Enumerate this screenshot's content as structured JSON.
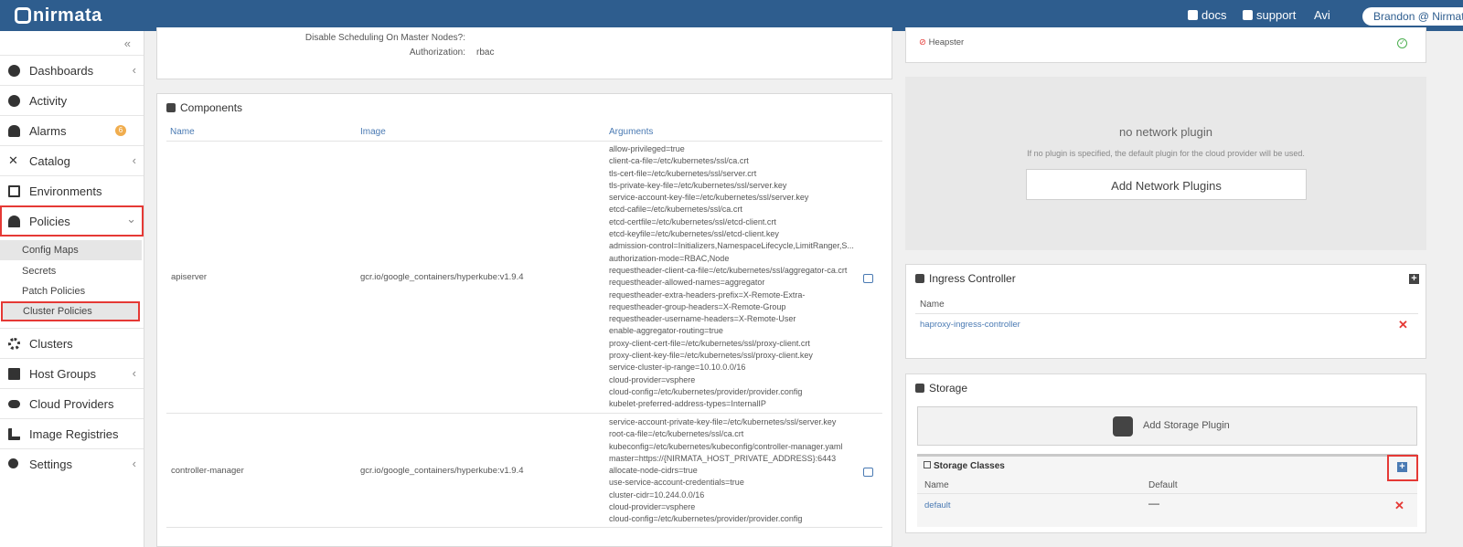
{
  "topbar": {
    "brand": "nirmata",
    "docs_label": "docs",
    "support_label": "support",
    "user_short": "Avi",
    "user_full": "Brandon @ Nirmata"
  },
  "sidebar": {
    "collapse_glyph": "«",
    "items": [
      {
        "label": "Dashboards",
        "icon": "dashboard-icon",
        "chevron": "‹"
      },
      {
        "label": "Activity",
        "icon": "activity-icon"
      },
      {
        "label": "Alarms",
        "icon": "bell-icon",
        "badge": "6"
      },
      {
        "label": "Catalog",
        "icon": "catalog-icon",
        "chevron": "‹"
      },
      {
        "label": "Environments",
        "icon": "environments-icon"
      },
      {
        "label": "Policies",
        "icon": "umbrella-icon",
        "chevron": "⌄"
      },
      {
        "label": "Clusters",
        "icon": "clusters-icon"
      },
      {
        "label": "Host Groups",
        "icon": "host-groups-icon",
        "chevron": "‹"
      },
      {
        "label": "Cloud Providers",
        "icon": "cloud-icon"
      },
      {
        "label": "Image Registries",
        "icon": "registries-icon"
      },
      {
        "label": "Settings",
        "icon": "gear-icon",
        "chevron": "‹"
      }
    ],
    "policies_sub": [
      "Config Maps",
      "Secrets",
      "Patch Policies",
      "Cluster Policies"
    ]
  },
  "cluster_settings": {
    "scheduling_label": "Disable Scheduling On Master Nodes?:",
    "scheduling_value": "",
    "authorization_label": "Authorization:",
    "authorization_value": "rbac"
  },
  "components": {
    "title": "Components",
    "headers": {
      "name": "Name",
      "image": "Image",
      "arguments": "Arguments"
    },
    "rows": [
      {
        "name": "apiserver",
        "image": "gcr.io/google_containers/hyperkube:v1.9.4",
        "arguments": "allow-privileged=true\nclient-ca-file=/etc/kubernetes/ssl/ca.crt\ntls-cert-file=/etc/kubernetes/ssl/server.crt\ntls-private-key-file=/etc/kubernetes/ssl/server.key\nservice-account-key-file=/etc/kubernetes/ssl/server.key\netcd-cafile=/etc/kubernetes/ssl/ca.crt\netcd-certfile=/etc/kubernetes/ssl/etcd-client.crt\netcd-keyfile=/etc/kubernetes/ssl/etcd-client.key\nadmission-control=Initializers,NamespaceLifecycle,LimitRanger,S...\nauthorization-mode=RBAC,Node\nrequestheader-client-ca-file=/etc/kubernetes/ssl/aggregator-ca.crt\nrequestheader-allowed-names=aggregator\nrequestheader-extra-headers-prefix=X-Remote-Extra-\nrequestheader-group-headers=X-Remote-Group\nrequestheader-username-headers=X-Remote-User\nenable-aggregator-routing=true\nproxy-client-cert-file=/etc/kubernetes/ssl/proxy-client.crt\nproxy-client-key-file=/etc/kubernetes/ssl/proxy-client.key\nservice-cluster-ip-range=10.10.0.0/16\ncloud-provider=vsphere\ncloud-config=/etc/kubernetes/provider/provider.config\nkubelet-preferred-address-types=InternalIP"
      },
      {
        "name": "controller-manager",
        "image": "gcr.io/google_containers/hyperkube:v1.9.4",
        "arguments": "service-account-private-key-file=/etc/kubernetes/ssl/server.key\nroot-ca-file=/etc/kubernetes/ssl/ca.crt\nkubeconfig=/etc/kubernetes/kubeconfig/controller-manager.yaml\nmaster=https://{NIRMATA_HOST_PRIVATE_ADDRESS}:6443\nallocate-node-cidrs=true\nuse-service-account-credentials=true\ncluster-cidr=10.244.0.0/16\ncloud-provider=vsphere\ncloud-config=/etc/kubernetes/provider/provider.config"
      }
    ]
  },
  "addons": {
    "heapster_label": "Heapster"
  },
  "network": {
    "empty_title": "no network plugin",
    "empty_desc": "If no plugin is specified, the default plugin for the cloud provider will be used.",
    "add_button": "Add Network Plugins"
  },
  "ingress": {
    "title": "Ingress Controller",
    "header_name": "Name",
    "rows": [
      {
        "name": "haproxy-ingress-controller"
      }
    ]
  },
  "storage": {
    "title": "Storage",
    "add_button": "Add Storage Plugin",
    "classes_title": "Storage Classes",
    "headers": {
      "name": "Name",
      "default": "Default"
    },
    "rows": [
      {
        "name": "default",
        "default": "—"
      }
    ]
  },
  "colors": {
    "topbar": "#2e5d8e",
    "link": "#4a7ab3",
    "highlight": "#e53935",
    "badge": "#f0ad4e",
    "ok": "#4caf50"
  }
}
